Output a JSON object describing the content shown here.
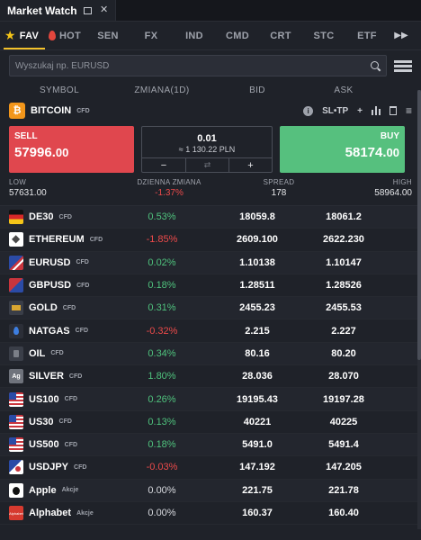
{
  "window": {
    "title": "Market Watch"
  },
  "tabs": [
    {
      "label": "FAV",
      "icon": "star-icon",
      "active": true
    },
    {
      "label": "HOT",
      "icon": "flame-icon",
      "active": false
    },
    {
      "label": "SEN"
    },
    {
      "label": "FX"
    },
    {
      "label": "IND"
    },
    {
      "label": "CMD"
    },
    {
      "label": "CRT"
    },
    {
      "label": "STC"
    },
    {
      "label": "ETF"
    }
  ],
  "more_tabs_glyph": "▶▶",
  "search": {
    "placeholder": "Wyszukaj np. EURUSD"
  },
  "columns": {
    "symbol": "SYMBOL",
    "change": "ZMIANA(1D)",
    "bid": "BID",
    "ask": "ASK"
  },
  "selected": {
    "symbol": "BITCOIN",
    "tag": "CFD",
    "icon": "bitcoin-icon",
    "sltp_label": "SL•TP",
    "sell_label": "SELL",
    "sell_price_main": "57996.",
    "sell_price_frac": "00",
    "buy_label": "BUY",
    "buy_price_main": "58174.",
    "buy_price_frac": "00",
    "volume": "0.01",
    "volume_value": "≈ 1 130.22 PLN",
    "minus": "−",
    "plus": "+",
    "swap": "⇄",
    "low_label": "LOW",
    "low": "57631.00",
    "daily_label": "DZIENNA ZMIANA",
    "daily": "-1.37%",
    "spread_label": "SPREAD",
    "spread": "178",
    "high_label": "HIGH",
    "high": "58964.00"
  },
  "rows": [
    {
      "symbol": "DE30",
      "tag": "CFD",
      "icon": "germany-flag-icon",
      "change": "0.53%",
      "dir": "pos",
      "bid": "18059.8",
      "ask": "18061.2"
    },
    {
      "symbol": "ETHEREUM",
      "tag": "CFD",
      "icon": "ethereum-icon",
      "change": "-1.85%",
      "dir": "neg",
      "bid": "2609.100",
      "ask": "2622.230"
    },
    {
      "symbol": "EURUSD",
      "tag": "CFD",
      "icon": "eur-usd-flag-icon",
      "change": "0.02%",
      "dir": "pos",
      "bid": "1.10138",
      "ask": "1.10147"
    },
    {
      "symbol": "GBPUSD",
      "tag": "CFD",
      "icon": "gbp-usd-flag-icon",
      "change": "0.18%",
      "dir": "pos",
      "bid": "1.28511",
      "ask": "1.28526"
    },
    {
      "symbol": "GOLD",
      "tag": "CFD",
      "icon": "gold-bar-icon",
      "change": "0.31%",
      "dir": "pos",
      "bid": "2455.23",
      "ask": "2455.53"
    },
    {
      "symbol": "NATGAS",
      "tag": "CFD",
      "icon": "gas-flame-icon",
      "change": "-0.32%",
      "dir": "neg",
      "bid": "2.215",
      "ask": "2.227"
    },
    {
      "symbol": "OIL",
      "tag": "CFD",
      "icon": "oil-barrel-icon",
      "change": "0.34%",
      "dir": "pos",
      "bid": "80.16",
      "ask": "80.20"
    },
    {
      "symbol": "SILVER",
      "tag": "CFD",
      "icon": "silver-icon",
      "badge": "Ag",
      "change": "1.80%",
      "dir": "pos",
      "bid": "28.036",
      "ask": "28.070"
    },
    {
      "symbol": "US100",
      "tag": "CFD",
      "icon": "us-flag-icon",
      "change": "0.26%",
      "dir": "pos",
      "bid": "19195.43",
      "ask": "19197.28"
    },
    {
      "symbol": "US30",
      "tag": "CFD",
      "icon": "us-flag-icon",
      "change": "0.13%",
      "dir": "pos",
      "bid": "40221",
      "ask": "40225"
    },
    {
      "symbol": "US500",
      "tag": "CFD",
      "icon": "us-flag-icon",
      "change": "0.18%",
      "dir": "pos",
      "bid": "5491.0",
      "ask": "5491.4"
    },
    {
      "symbol": "USDJPY",
      "tag": "CFD",
      "icon": "usd-jpy-flag-icon",
      "change": "-0.03%",
      "dir": "neg",
      "bid": "147.192",
      "ask": "147.205"
    },
    {
      "symbol": "Apple",
      "tag": "Akcje",
      "icon": "apple-logo-icon",
      "change": "0.00%",
      "dir": "zero",
      "bid": "221.75",
      "ask": "221.78"
    },
    {
      "symbol": "Alphabet",
      "tag": "Akcje",
      "icon": "alphabet-logo-icon",
      "badge": "Alphabet",
      "change": "0.00%",
      "dir": "zero",
      "bid": "160.37",
      "ask": "160.40"
    }
  ]
}
